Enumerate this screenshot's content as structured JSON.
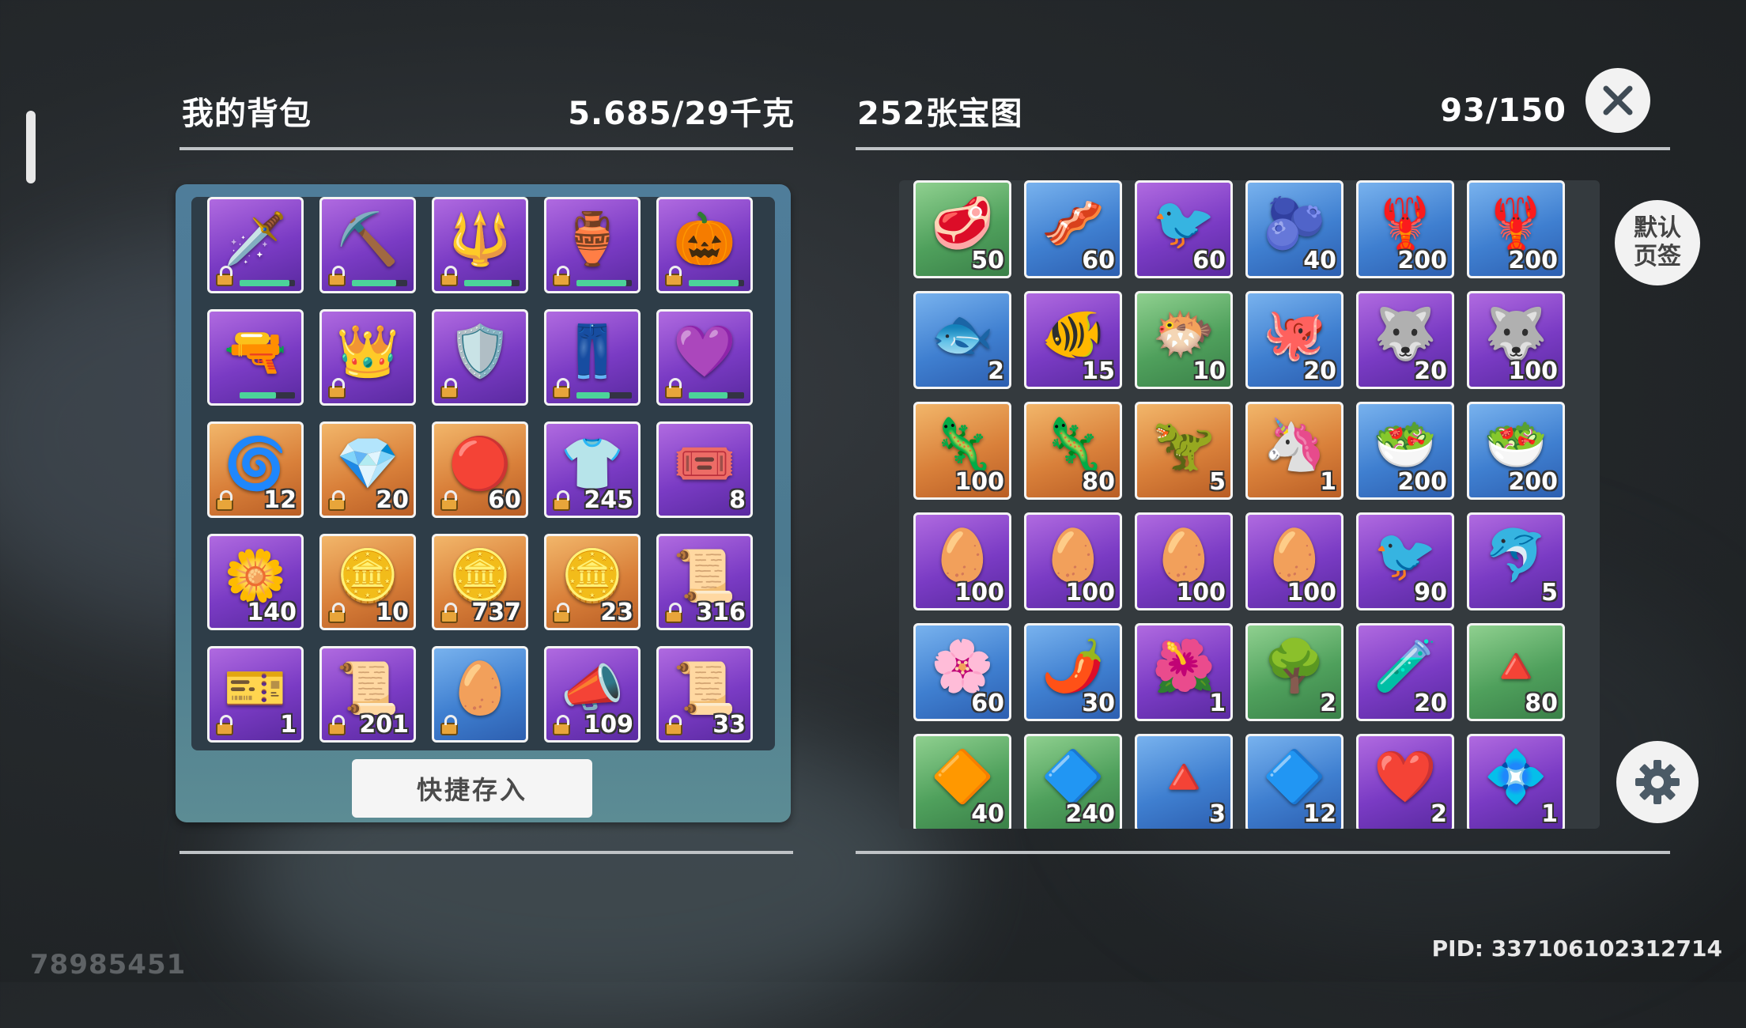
{
  "backpack": {
    "title": "我的背包",
    "weight": "5.685/29千克",
    "quick_store_label": "快捷存入",
    "items": [
      {
        "icon": "🗡️",
        "name": "sword-icon",
        "rarity": "purple",
        "count": "",
        "locked": true,
        "durability": 0.9
      },
      {
        "icon": "⛏️",
        "name": "pickaxe-icon",
        "rarity": "purple",
        "count": "",
        "locked": true,
        "durability": 0.8
      },
      {
        "icon": "🔱",
        "name": "trident-icon",
        "rarity": "purple",
        "count": "",
        "locked": true,
        "durability": 0.85
      },
      {
        "icon": "🏺",
        "name": "green-gourd-icon",
        "rarity": "purple",
        "count": "",
        "locked": true,
        "durability": 0.9
      },
      {
        "icon": "🎃",
        "name": "pumpkin-staff-icon",
        "rarity": "purple",
        "count": "",
        "locked": true,
        "durability": 0.9
      },
      {
        "icon": "🔫",
        "name": "rifle-icon",
        "rarity": "purple",
        "count": "",
        "locked": false,
        "durability": 0.65
      },
      {
        "icon": "👑",
        "name": "crystal-helmet-icon",
        "rarity": "purple",
        "count": "",
        "locked": true,
        "durability": 0
      },
      {
        "icon": "🛡️",
        "name": "armor-icon",
        "rarity": "purple",
        "count": "",
        "locked": true,
        "durability": 0
      },
      {
        "icon": "👖",
        "name": "leggings-icon",
        "rarity": "purple",
        "count": "",
        "locked": true,
        "durability": 0.6
      },
      {
        "icon": "💜",
        "name": "amulet-icon",
        "rarity": "purple",
        "count": "",
        "locked": true,
        "durability": 0.7
      },
      {
        "icon": "🌀",
        "name": "vortex-sun-icon",
        "rarity": "orange",
        "count": "12",
        "locked": true
      },
      {
        "icon": "💎",
        "name": "purple-crystal-icon",
        "rarity": "orange",
        "count": "20",
        "locked": true
      },
      {
        "icon": "🔴",
        "name": "red-coin-icon",
        "rarity": "orange",
        "count": "60",
        "locked": true
      },
      {
        "icon": "👕",
        "name": "gold-shirt-icon",
        "rarity": "purple",
        "count": "245",
        "locked": true
      },
      {
        "icon": "🎟️",
        "name": "purple-ticket-icon",
        "rarity": "purple",
        "count": "8",
        "locked": false
      },
      {
        "icon": "🌼",
        "name": "yellow-flower-icon",
        "rarity": "purple",
        "count": "140",
        "locked": false
      },
      {
        "icon": "🪙",
        "name": "bow-coin-icon",
        "rarity": "orange",
        "count": "10",
        "locked": true
      },
      {
        "icon": "🪙",
        "name": "leaf-coin-icon",
        "rarity": "orange",
        "count": "737",
        "locked": true
      },
      {
        "icon": "🪙",
        "name": "wing-coin-icon",
        "rarity": "orange",
        "count": "23",
        "locked": true
      },
      {
        "icon": "📜",
        "name": "wanted-poster-icon",
        "rarity": "purple",
        "count": "316",
        "locked": true
      },
      {
        "icon": "🎫",
        "name": "crown-ticket-icon",
        "rarity": "purple",
        "count": "1",
        "locked": true
      },
      {
        "icon": "📜",
        "name": "wanted-scroll-icon",
        "rarity": "purple",
        "count": "201",
        "locked": true
      },
      {
        "icon": "🥚",
        "name": "stone-egg-icon",
        "rarity": "blue",
        "count": "",
        "locked": true
      },
      {
        "icon": "📣",
        "name": "megaphone-icon",
        "rarity": "purple",
        "count": "109",
        "locked": true
      },
      {
        "icon": "📜",
        "name": "gold-scroll-icon",
        "rarity": "purple",
        "count": "33",
        "locked": true
      }
    ]
  },
  "storage": {
    "title": "252张宝图",
    "capacity": "93/150",
    "items": [
      {
        "icon": "🥩",
        "name": "raw-meat-icon",
        "rarity": "green",
        "count": "50"
      },
      {
        "icon": "🥓",
        "name": "bacon-icon",
        "rarity": "blue",
        "count": "60"
      },
      {
        "icon": "🐦",
        "name": "bird-feed-icon",
        "rarity": "purple",
        "count": "60"
      },
      {
        "icon": "🫐",
        "name": "berry-bowl-icon",
        "rarity": "blue",
        "count": "40"
      },
      {
        "icon": "🦞",
        "name": "lobster-icon",
        "rarity": "blue",
        "count": "200"
      },
      {
        "icon": "🦞",
        "name": "lobster-icon",
        "rarity": "blue",
        "count": "200"
      },
      {
        "icon": "🐟",
        "name": "fish-icon",
        "rarity": "blue",
        "count": "2"
      },
      {
        "icon": "🐠",
        "name": "arowana-icon",
        "rarity": "purple",
        "count": "15"
      },
      {
        "icon": "🐡",
        "name": "anglerfish-icon",
        "rarity": "green",
        "count": "10"
      },
      {
        "icon": "🐙",
        "name": "octopus-icon",
        "rarity": "blue",
        "count": "20"
      },
      {
        "icon": "🐺",
        "name": "wolf-feed-icon",
        "rarity": "purple",
        "count": "20"
      },
      {
        "icon": "🐺",
        "name": "wolf-feed-icon",
        "rarity": "purple",
        "count": "100"
      },
      {
        "icon": "🦎",
        "name": "lizard-feed-icon",
        "rarity": "orange",
        "count": "100"
      },
      {
        "icon": "🦎",
        "name": "lizard-feed-icon",
        "rarity": "orange",
        "count": "80"
      },
      {
        "icon": "🦖",
        "name": "dino-feed-icon",
        "rarity": "orange",
        "count": "5"
      },
      {
        "icon": "🦄",
        "name": "unicorn-feed-icon",
        "rarity": "orange",
        "count": "1"
      },
      {
        "icon": "🥗",
        "name": "fish-dish-icon",
        "rarity": "blue",
        "count": "200"
      },
      {
        "icon": "🥗",
        "name": "fish-dish-icon",
        "rarity": "blue",
        "count": "200"
      },
      {
        "icon": "🥚",
        "name": "golden-egg-icon",
        "rarity": "purple",
        "count": "100"
      },
      {
        "icon": "🥚",
        "name": "golden-egg-icon",
        "rarity": "purple",
        "count": "100"
      },
      {
        "icon": "🥚",
        "name": "golden-egg-icon",
        "rarity": "purple",
        "count": "100"
      },
      {
        "icon": "🥚",
        "name": "golden-egg-icon",
        "rarity": "purple",
        "count": "100"
      },
      {
        "icon": "🐦",
        "name": "bird-feed-icon",
        "rarity": "purple",
        "count": "90"
      },
      {
        "icon": "🐬",
        "name": "fish-feed-icon",
        "rarity": "purple",
        "count": "5"
      },
      {
        "icon": "🌸",
        "name": "white-flower-icon",
        "rarity": "blue",
        "count": "60"
      },
      {
        "icon": "🌶️",
        "name": "pepper-sack-icon",
        "rarity": "blue",
        "count": "30"
      },
      {
        "icon": "🌺",
        "name": "flower-sack-icon",
        "rarity": "purple",
        "count": "1"
      },
      {
        "icon": "🌳",
        "name": "seed-sack-icon",
        "rarity": "green",
        "count": "2"
      },
      {
        "icon": "🧪",
        "name": "potion-icon",
        "rarity": "purple",
        "count": "20"
      },
      {
        "icon": "🔺",
        "name": "red-ore-icon",
        "rarity": "green",
        "count": "80"
      },
      {
        "icon": "🔶",
        "name": "gold-ore-icon",
        "rarity": "green",
        "count": "40"
      },
      {
        "icon": "🔷",
        "name": "blue-ore-icon",
        "rarity": "green",
        "count": "240"
      },
      {
        "icon": "🔺",
        "name": "ruby-cluster-icon",
        "rarity": "blue",
        "count": "3"
      },
      {
        "icon": "🔷",
        "name": "sapphire-cluster-icon",
        "rarity": "blue",
        "count": "12"
      },
      {
        "icon": "❤️",
        "name": "red-crystal-icon",
        "rarity": "purple",
        "count": "2"
      },
      {
        "icon": "💠",
        "name": "blue-crystal-icon",
        "rarity": "purple",
        "count": "1"
      }
    ]
  },
  "default_tab_label": "默认页签",
  "corner_id": "78985451",
  "pid": "PID: 337106102312714",
  "colors": {
    "accent": "#f2f2f2",
    "panel": "#4f7d9a",
    "purple": "#7a3bc4",
    "orange": "#d9803a",
    "blue": "#3f7fd0",
    "green": "#4fa05c"
  }
}
